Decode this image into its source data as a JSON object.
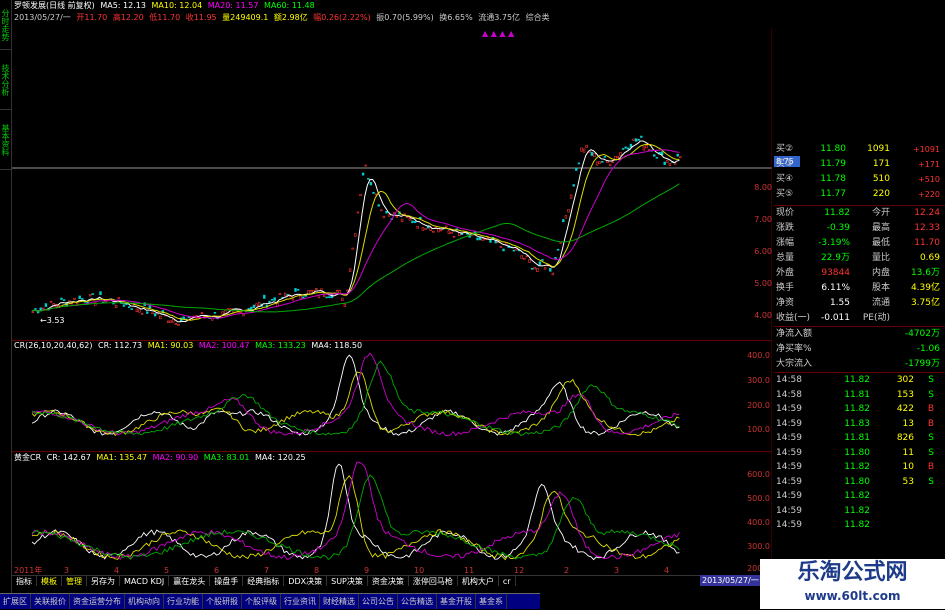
{
  "left_tabs": [
    "分时走势",
    "技术分析",
    "基本资料"
  ],
  "info": {
    "title": "罗顿发展(日线 前复权)",
    "ma5": "MA5: 12.13",
    "ma10": "MA10: 12.04",
    "ma20": "MA20: 11.57",
    "ma60": "MA60: 11.48",
    "date": "2013/05/27/一",
    "open": "开11.70",
    "high": "高12.20",
    "low": "低11.70",
    "close": "收11.95",
    "vol": "量249409.1",
    "amt": "额2.98亿",
    "chg": "幅0.26(2.22%)",
    "amp": "振0.70(5.99%)",
    "turn": "换6.65%",
    "float": "流通3.75亿",
    "cat": "综合类"
  },
  "main_axis": [
    "8.00",
    "7.00",
    "6.00",
    "5.00",
    "4.00"
  ],
  "low_label": "←3.53",
  "price_marker": "8.75",
  "cr": {
    "title": "CR(26,10,20,40,62)",
    "cr": "CR: 112.73",
    "ma1": "MA1: 90.03",
    "ma2": "MA2: 100.47",
    "ma3": "MA3: 133.23",
    "ma4": "MA4: 118.50",
    "axis": [
      "400.0",
      "300.0",
      "200.0",
      "100.0"
    ]
  },
  "gold": {
    "title": "黄金CR",
    "cr": "CR: 142.67",
    "ma1": "MA1: 135.47",
    "ma2": "MA2: 90.90",
    "ma3": "MA3: 83.01",
    "ma4": "MA4: 120.25",
    "axis": [
      "600.0",
      "500.0",
      "400.0",
      "300.0",
      "200.0"
    ]
  },
  "x_labels": [
    "2011年",
    "3",
    "4",
    "5",
    "6",
    "7",
    "8",
    "9",
    "10",
    "11",
    "12",
    "2",
    "3",
    "4"
  ],
  "date_box": "2013/05/27/一",
  "asks": [
    {
      "label": "买②",
      "price": "11.80",
      "vol": "1091",
      "chg": "+1091"
    },
    {
      "label": "买③",
      "price": "11.79",
      "vol": "171",
      "chg": "+171"
    },
    {
      "label": "买④",
      "price": "11.78",
      "vol": "510",
      "chg": "+510"
    },
    {
      "label": "买⑤",
      "price": "11.77",
      "vol": "220",
      "chg": "+220"
    }
  ],
  "stats": [
    {
      "k1": "现价",
      "v1": "11.82",
      "k2": "今开",
      "v2": "12.24"
    },
    {
      "k1": "涨跌",
      "v1": "-0.39",
      "k2": "最高",
      "v2": "12.33"
    },
    {
      "k1": "涨幅",
      "v1": "-3.19%",
      "k2": "最低",
      "v2": "11.70"
    },
    {
      "k1": "总量",
      "v1": "22.9万",
      "k2": "量比",
      "v2": "0.69"
    },
    {
      "k1": "外盘",
      "v1": "93844",
      "k2": "内盘",
      "v2": "13.6万"
    },
    {
      "k1": "换手",
      "v1": "6.11%",
      "k2": "股本",
      "v2": "4.39亿"
    },
    {
      "k1": "净资",
      "v1": "1.55",
      "k2": "流通",
      "v2": "3.75亿"
    },
    {
      "k1": "收益(一)",
      "v1": "-0.011",
      "k2": "PE(动)",
      "v2": ""
    }
  ],
  "flows": [
    {
      "k": "净流入额",
      "v": "-4702万"
    },
    {
      "k": "净买率%",
      "v": "-1.06"
    },
    {
      "k": "大宗流入",
      "v": "-1799万"
    }
  ],
  "ticks": [
    {
      "t": "14:58",
      "p": "11.82",
      "v": "302",
      "s": "S"
    },
    {
      "t": "14:58",
      "p": "11.81",
      "v": "153",
      "s": "S"
    },
    {
      "t": "14:59",
      "p": "11.82",
      "v": "422",
      "s": "B"
    },
    {
      "t": "14:59",
      "p": "11.83",
      "v": "13",
      "s": "B"
    },
    {
      "t": "14:59",
      "p": "11.81",
      "v": "826",
      "s": "S"
    },
    {
      "t": "14:59",
      "p": "11.80",
      "v": "11",
      "s": "S"
    },
    {
      "t": "14:59",
      "p": "11.82",
      "v": "10",
      "s": "B"
    },
    {
      "t": "14:59",
      "p": "11.80",
      "v": "53",
      "s": "S"
    },
    {
      "t": "14:59",
      "p": "11.82",
      "v": "",
      "s": ""
    },
    {
      "t": "14:59",
      "p": "11.82",
      "v": "",
      "s": ""
    },
    {
      "t": "14:59",
      "p": "11.82",
      "v": "",
      "s": ""
    }
  ],
  "bar1": [
    "指标",
    "模板",
    "管理",
    "另存为",
    "MACD KDJ",
    "赢在龙头",
    "操盘手",
    "经典指标",
    "DDX决策",
    "SUP决策",
    "资金决策",
    "涨停回马枪",
    "机构大户",
    "cr"
  ],
  "bar2": [
    "扩展区",
    "关联报价",
    "资金运营分布",
    "机构动向",
    "行业功能",
    "个股研报",
    "个股评级",
    "行业资讯",
    "财经精选",
    "公司公告",
    "公告精选",
    "基金开股",
    "基金系"
  ],
  "watermark": {
    "cn": "乐淘公式网",
    "url": "www.60lt.com"
  }
}
